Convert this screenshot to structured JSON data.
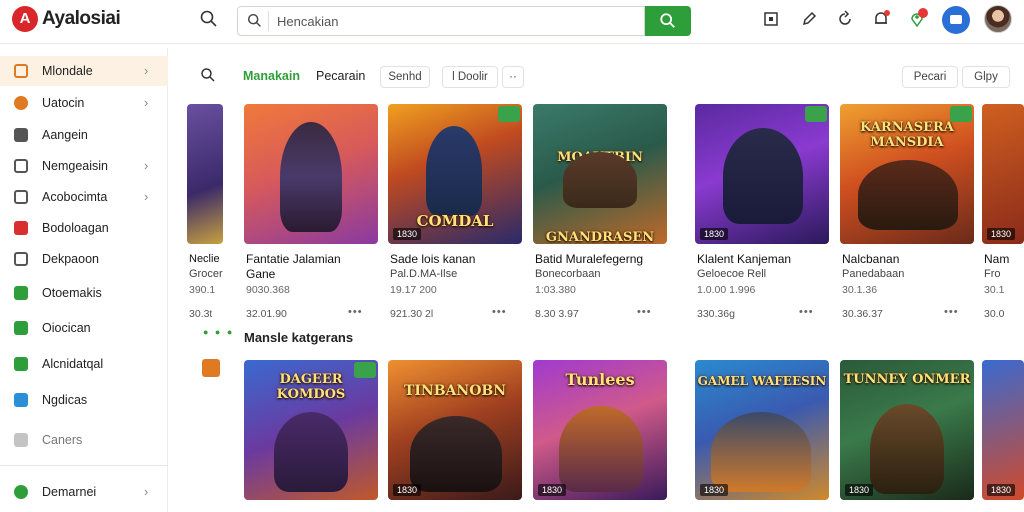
{
  "app": {
    "logo_mark": "A",
    "title": "Ayalosiai"
  },
  "search": {
    "placeholder": "Hencakian",
    "value": "Hencakian"
  },
  "sidebar": {
    "items": [
      {
        "label": "Mlondale",
        "chevron": "›",
        "color": "#e07a22"
      },
      {
        "label": "Uatocin",
        "chevron": "›",
        "color": "#e07a22"
      },
      {
        "label": "Aangein",
        "chevron": "",
        "color": "#555555"
      },
      {
        "label": "Nemgeaisin",
        "chevron": "›",
        "color": "#555555"
      },
      {
        "label": "Acobocimta",
        "chevron": "›",
        "color": "#555555"
      },
      {
        "label": "Bodoloagan",
        "chevron": "",
        "color": "#d9302f"
      },
      {
        "label": "Dekpaoon",
        "chevron": "",
        "color": "#555555"
      },
      {
        "label": "Otoemakis",
        "chevron": "",
        "color": "#2e9e3a"
      },
      {
        "label": "Oiocican",
        "chevron": "",
        "color": "#2e9e3a"
      },
      {
        "label": "Alcnidatqal",
        "chevron": "",
        "color": "#2e9e3a"
      },
      {
        "label": "Ngdicas",
        "chevron": "",
        "color": "#2a8fd6"
      },
      {
        "label": "Caners",
        "chevron": "",
        "color": "#9a9a9a"
      },
      {
        "label": "Demarnei",
        "chevron": "›",
        "color": "#2e9e3a"
      }
    ]
  },
  "filters": {
    "tabs": [
      "Manakain",
      "Pecarain"
    ],
    "pills": [
      "Senhd",
      "l Doolir",
      "··"
    ],
    "right_pills": [
      "Pecari",
      "Glpy"
    ]
  },
  "row1": [
    {
      "title": "",
      "name": "Neclie",
      "sub": "Grocer",
      "meta": "390.1",
      "price": "30.3t",
      "tag": ""
    },
    {
      "title": "",
      "name": "Fantatie Jalamian",
      "sub": "Gane",
      "meta": "9030.368",
      "price": "32.01.90",
      "tag": ""
    },
    {
      "title": "COMDAL",
      "name": "Sade lois kanan",
      "sub": "Pal.D.MA-Ilse",
      "meta": "19.17 200",
      "price": "921.30 2l",
      "tag": "1830"
    },
    {
      "title": "MOAUTBIN GNANDRASEN",
      "name": "Batid Muralefegerng",
      "sub": "Bonecorbaan",
      "meta": "1:03.380",
      "price": "8.30 3.97",
      "tag": ""
    },
    {
      "title": "",
      "name": "Klalent Kanjeman",
      "sub": "Geloecoe Rell",
      "meta": "1.0.00 1.996",
      "price": "330.36g",
      "tag": "1830"
    },
    {
      "title": "KARNASERA MANSDIA",
      "name": "Nalcbanan",
      "sub": "Panedabaan",
      "meta": "30.1.36",
      "price": "30.36.37",
      "tag": ""
    },
    {
      "title": "",
      "name": "Nam",
      "sub": "Fro",
      "meta": "30.1",
      "price": "30.0",
      "tag": "1830"
    }
  ],
  "section": {
    "title": "Mansle katgerans"
  },
  "row2": [
    {
      "title": "DAGEER KOMDOS",
      "tag": ""
    },
    {
      "title": "TINBANOBN",
      "tag": "1830"
    },
    {
      "title": "Tunlees",
      "tag": "1830"
    },
    {
      "title": "GAMEL WAFEESIN",
      "tag": "1830"
    },
    {
      "title": "TUNNEY ONMER",
      "tag": "1830"
    },
    {
      "title": "",
      "tag": "1830"
    }
  ],
  "colors": {
    "accent": "#2e9e3a",
    "brand": "#d8262b",
    "active_bg": "#fdf1e4"
  },
  "icons": [
    "search-icon",
    "square-icon",
    "pen-icon",
    "refresh-icon",
    "bell-icon",
    "location-icon",
    "chat-icon",
    "avatar"
  ]
}
